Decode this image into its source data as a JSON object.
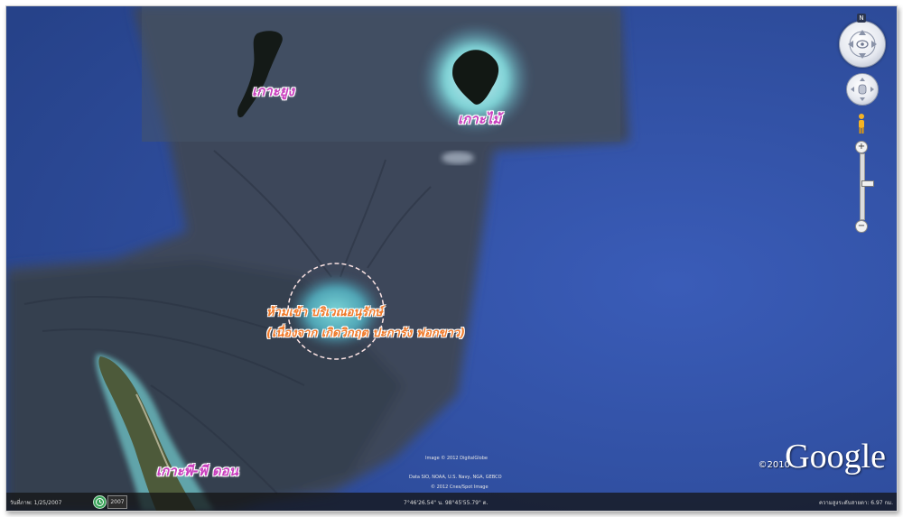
{
  "map": {
    "labels": {
      "koh_yung": "เกาะยูง",
      "koh_mai": "เกาะไม้",
      "koh_phi_phi_don": "เกาะพี-พี ดอน",
      "site_line1": "ห้ามเข้า บริเวณอนุรักษ์",
      "site_line2": "(เนื่องจาก เกิดวิกฤต ปะการัง ฟอกขาว)"
    },
    "image_credits": {
      "line1": "Image © 2012 DigitalGlobe",
      "line2": "Data SIO, NOAA, U.S. Navy, NGA, GEBCO",
      "line3": "© 2012 Cnes/Spot Image"
    },
    "google_logo": "Google",
    "copyright_year": "©2010"
  },
  "statusbar": {
    "imagery_date": "วันที่ภาพ: 1/25/2007",
    "year": "2007",
    "coordinates": "7°46'26.54\" น. 98°45'55.79\" ต.",
    "eye_alt": "ความสูงระดับสายตา: 6.97 กม."
  },
  "nav": {
    "north_label": "N",
    "zoom_in": "+",
    "zoom_out": "−",
    "zoom_level_fraction": 0.45
  },
  "colors": {
    "ocean": "#2c4a9c",
    "island_label": "#c93fbe",
    "site_label": "#f07a2a"
  }
}
